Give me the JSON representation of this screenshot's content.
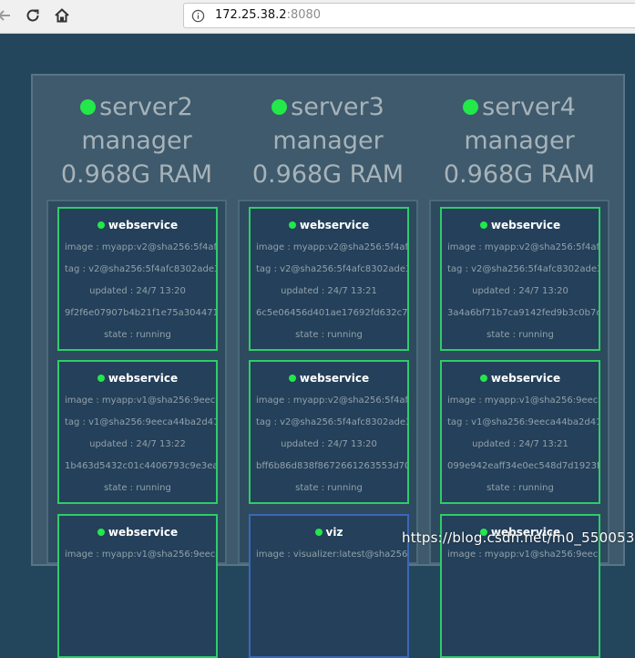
{
  "browser": {
    "url_host": "172.25.38.2",
    "url_port": ":8080",
    "icons": [
      "back-arrow-icon",
      "reload-icon",
      "home-icon",
      "info-icon"
    ]
  },
  "colors": {
    "running": "#22e84a",
    "task_border": "#2fcc6a",
    "viz_border": "#3b67b8"
  },
  "nodes": [
    {
      "name": "server2",
      "role": "manager",
      "ram": "0.968G RAM",
      "tasks": [
        {
          "name": "webservice",
          "image": "image : myapp:v2@sha256:5f4afc8",
          "tag": "tag : v2@sha256:5f4afc8302ade316",
          "updated": "updated : 24/7 13:20",
          "id": "9f2f6e07907b4b21f1e75a3044710f",
          "state": "state : running"
        },
        {
          "name": "webservice",
          "image": "image : myapp:v1@sha256:9eeca44",
          "tag": "tag : v1@sha256:9eeca44ba2d410e",
          "updated": "updated : 24/7 13:22",
          "id": "1b463d5432c01c4406793c9e3eab7",
          "state": "state : running"
        },
        {
          "name": "webservice",
          "image": "image : myapp:v1@sha256:9eeca44"
        }
      ]
    },
    {
      "name": "server3",
      "role": "manager",
      "ram": "0.968G RAM",
      "tasks": [
        {
          "name": "webservice",
          "image": "image : myapp:v2@sha256:5f4afc8",
          "tag": "tag : v2@sha256:5f4afc8302ade316",
          "updated": "updated : 24/7 13:21",
          "id": "6c5e06456d401ae17692fd632c7f9",
          "state": "state : running"
        },
        {
          "name": "webservice",
          "image": "image : myapp:v2@sha256:5f4afc8",
          "tag": "tag : v2@sha256:5f4afc8302ade316",
          "updated": "updated : 24/7 13:20",
          "id": "bff6b86d838f8672661263553d701",
          "state": "state : running"
        },
        {
          "name": "viz",
          "image": "image : visualizer:latest@sha256:c"
        }
      ]
    },
    {
      "name": "server4",
      "role": "manager",
      "ram": "0.968G RAM",
      "tasks": [
        {
          "name": "webservice",
          "image": "image : myapp:v2@sha256:5f4afc8",
          "tag": "tag : v2@sha256:5f4afc8302ade316",
          "updated": "updated : 24/7 13:20",
          "id": "3a4a6bf71b7ca9142fed9b3c0b7cfe",
          "state": "state : running"
        },
        {
          "name": "webservice",
          "image": "image : myapp:v1@sha256:9eeca44",
          "tag": "tag : v1@sha256:9eeca44ba2d410e",
          "updated": "updated : 24/7 13:21",
          "id": "099e942eaff34e0ec548d7d1923fa6",
          "state": "state : running"
        },
        {
          "name": "webservice",
          "image": "image : myapp:v1@sha256:9eeca44"
        }
      ]
    }
  ],
  "watermark": "https://blog.csdn.net/m0_55005311"
}
